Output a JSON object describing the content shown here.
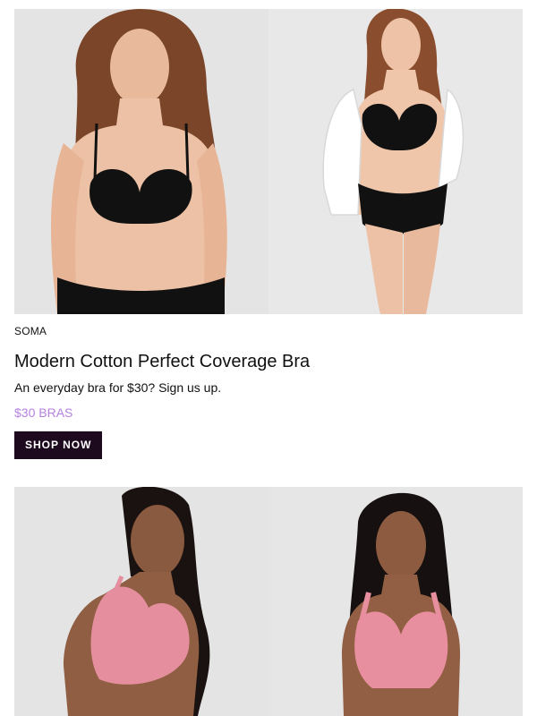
{
  "products": [
    {
      "brand": "SOMA",
      "title": "Modern Cotton Perfect Coverage Bra",
      "subtitle": "An everyday bra for $30? Sign us up.",
      "price_tag": "$30 BRAS",
      "cta_label": "SHOP NOW"
    }
  ],
  "colors": {
    "accent": "#b581e0",
    "cta_background": "#1e0a1e",
    "photo_background": "#e6e6e6",
    "black_garment": "#111111",
    "pink_garment": "#e58e9e"
  }
}
